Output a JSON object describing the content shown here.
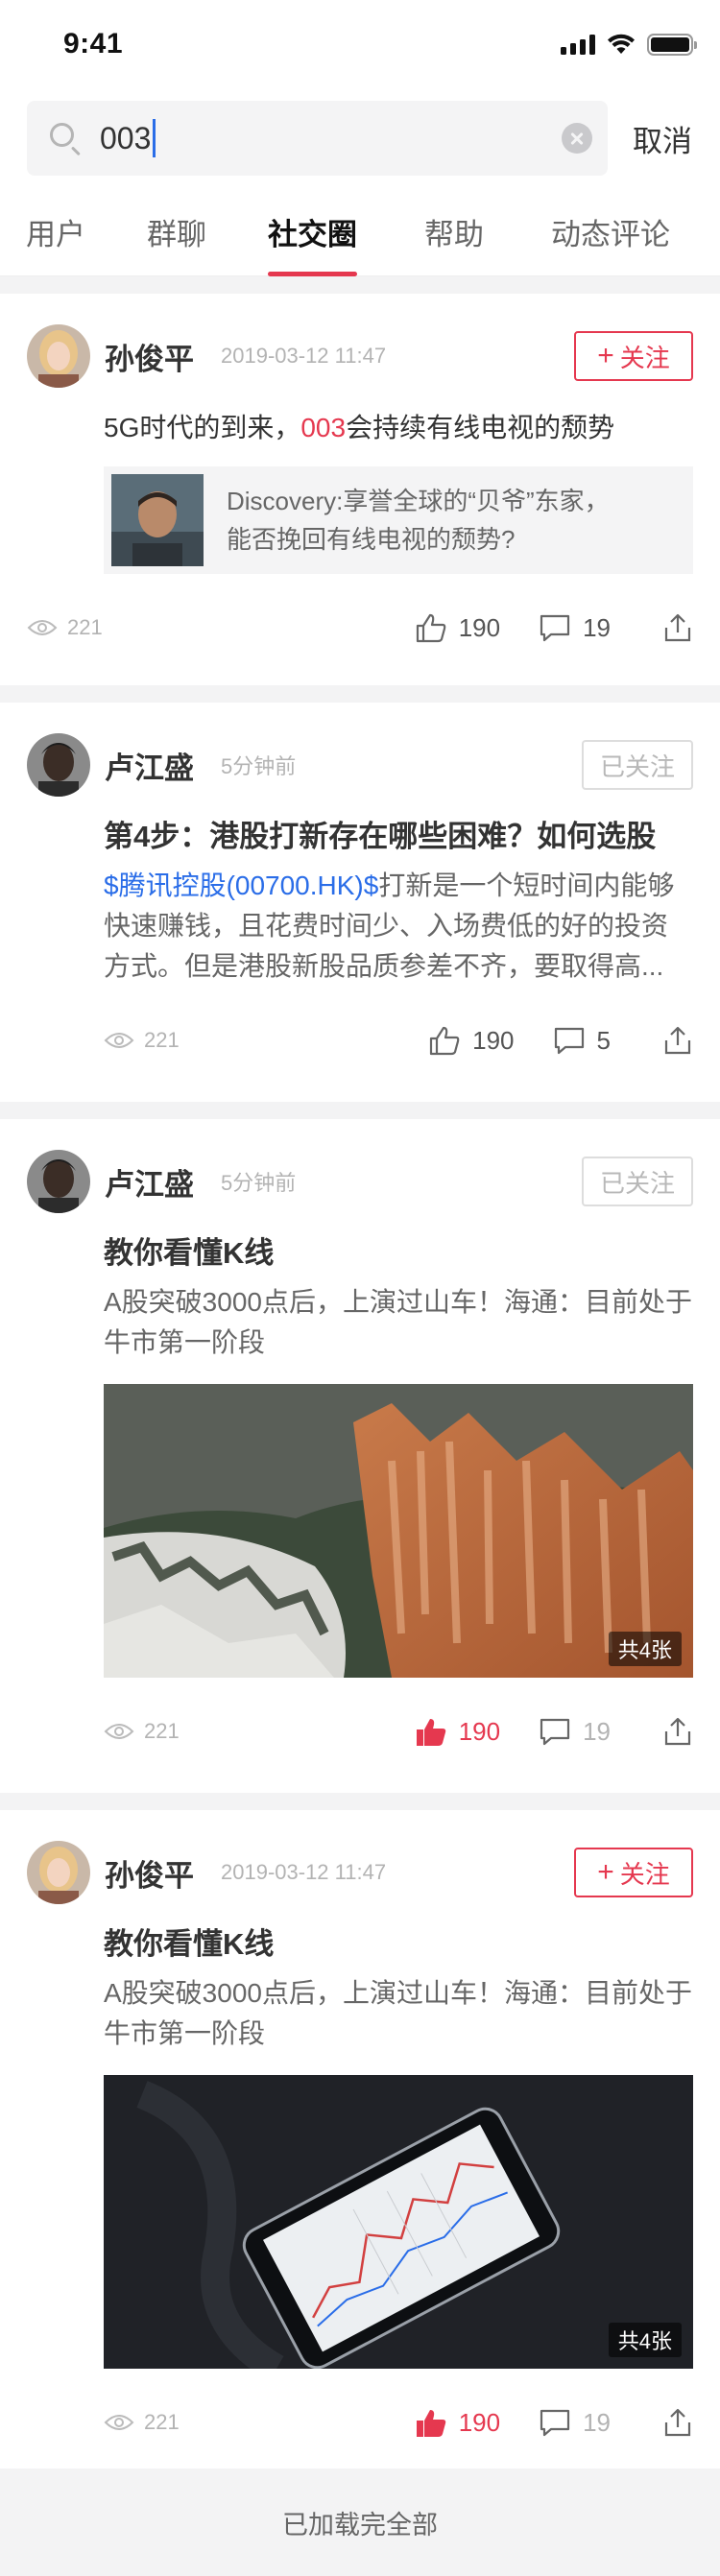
{
  "status_bar": {
    "time": "9:41"
  },
  "search": {
    "query": "003",
    "cancel_label": "取消"
  },
  "tabs": [
    {
      "label": "用户"
    },
    {
      "label": "群聊"
    },
    {
      "label": "社交圈",
      "active": true
    },
    {
      "label": "帮助"
    },
    {
      "label": "动态评论"
    }
  ],
  "posts": [
    {
      "author": "孙俊平",
      "time": "2019-03-12 11:47",
      "follow_label": "关注",
      "text_prefix": "5G时代的到来，",
      "text_highlight": "003",
      "text_suffix": "会持续有线电视的颓势",
      "link_line1": "Discovery:享誉全球的“贝爷”东家，",
      "link_line2": "能否挽回有线电视的颓势?",
      "views": "221",
      "likes": "190",
      "comments": "19"
    },
    {
      "author": "卢江盛",
      "time": "5分钟前",
      "follow_label": "已关注",
      "title": "第4步：港股打新存在哪些困难？如何选股",
      "stock": "$腾讯控股(00700.HK)$",
      "desc": "打新是一个短时间内能够快速赚钱，且花费时间少、入场费低的好的投资方式。但是港股新股品质参差不齐，要取得高...",
      "views": "221",
      "likes": "190",
      "comments": "5"
    },
    {
      "author": "卢江盛",
      "time": "5分钟前",
      "follow_label": "已关注",
      "title": "教你看懂K线",
      "desc": "A股突破3000点后，上演过山车！海通：目前处于牛市第一阶段",
      "image_count": "共4张",
      "views": "221",
      "likes": "190",
      "comments": "19"
    },
    {
      "author": "孙俊平",
      "time": "2019-03-12 11:47",
      "follow_label": "关注",
      "title": "教你看懂K线",
      "desc": "A股突破3000点后，上演过山车！海通：目前处于牛市第一阶段",
      "image_count": "共4张",
      "views": "221",
      "likes": "190",
      "comments": "19"
    }
  ],
  "footer": {
    "label": "已加载完全部"
  },
  "colors": {
    "accent": "#e5384f",
    "link": "#2a6de8",
    "muted": "#b3b3b3"
  }
}
